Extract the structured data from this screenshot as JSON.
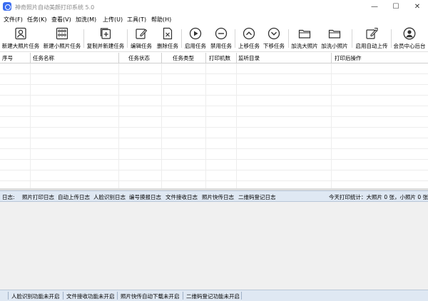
{
  "window": {
    "title": "神奇照片自动美颜打印系统 5.0",
    "minimize": "—",
    "maximize": "☐",
    "close": "✕"
  },
  "menu": [
    "文件(F)",
    "任务(K)",
    "查看(V)",
    "加洗(M)",
    "上传(U)",
    "工具(T)",
    "帮助(H)"
  ],
  "toolbar": {
    "new_large": "新建大照片任务",
    "new_small": "新建小照片任务",
    "copy_new": "复制并新建任务",
    "edit": "编辑任务",
    "delete": "删除任务",
    "enable": "启用任务",
    "disable": "禁用任务",
    "move_up": "上移任务",
    "move_down": "下移任务",
    "extra_large": "加洗大照片",
    "extra_small": "加洗小照片",
    "auto_upload": "启用自动上传",
    "member": "会员中心后台"
  },
  "grid": {
    "columns": [
      "序号",
      "任务名称",
      "任务状态",
      "任务类型",
      "打印机数",
      "监听目录",
      "打印后操作"
    ]
  },
  "log": {
    "label": "日志:",
    "tabs": [
      "照片打印日志",
      "自动上传日志",
      "人脸识别日志",
      "编号摸报日志",
      "文件接收日志",
      "照片快传日志",
      "二维码登记日志"
    ],
    "stats": "今天打印统计：大照片 0 张，小照片 0 张"
  },
  "status": [
    "人脸识别功能未开启",
    "文件接收功能未开启",
    "照片快传自动下载未开启",
    "二维码登记功能未开启"
  ],
  "colors": {
    "accent": "#3a6cf0",
    "log_bar": "#dfe8f3"
  }
}
